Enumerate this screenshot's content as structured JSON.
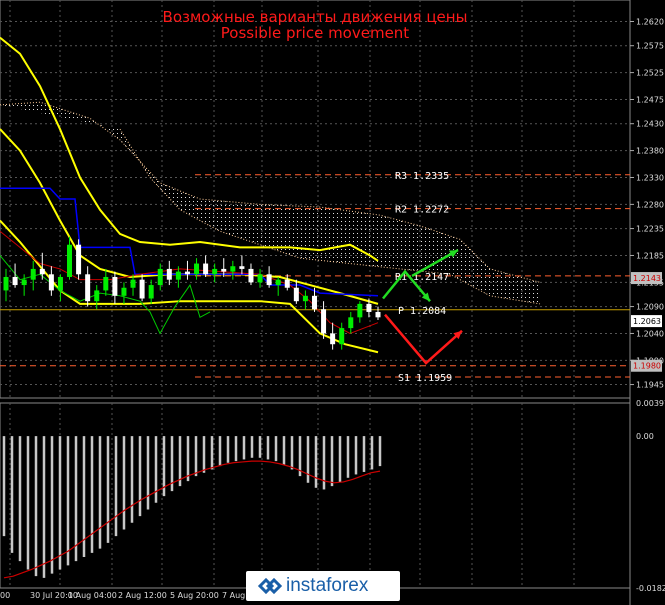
{
  "header": {
    "title_ru": "Возможные варианты движения цены",
    "title_en": "Possible price movement"
  },
  "chart_data": {
    "type": "candlestick",
    "instrument_note": "",
    "price_axis": {
      "ylim": [
        1.192,
        1.266
      ],
      "ticks": [
        "1.2620",
        "1.2575",
        "1.2525",
        "1.2475",
        "1.2430",
        "1.2380",
        "1.2330",
        "1.2280",
        "1.2235",
        "1.2185",
        "1.2135",
        "1.2090",
        "1.2040",
        "1.1990",
        "1.1945"
      ]
    },
    "current_price_tag": "1.2063",
    "marker_tags": [
      "1.2143",
      "1.1980"
    ],
    "time_axis": {
      "labels": [
        "00",
        "30 Jul 20:00",
        "1 Aug 04:00",
        "2 Aug 12:00",
        "5 Aug 20:00",
        "7 Aug"
      ]
    },
    "pivot_levels": [
      {
        "name": "R3",
        "label": "R3  1.2335",
        "value": 1.2335,
        "color": "#ff6030"
      },
      {
        "name": "R2",
        "label": "R2  1.2272",
        "value": 1.2272,
        "color": "#ff6030"
      },
      {
        "name": "R1",
        "label": "R1  1.2147",
        "value": 1.2147,
        "color": "#ff6030"
      },
      {
        "name": "P",
        "label": "P  1.2084",
        "value": 1.2084,
        "color": "#c8a000"
      },
      {
        "name": "S1",
        "label": "S1  1.1959",
        "value": 1.1959,
        "color": "#ff6030"
      }
    ],
    "forecast_arrows": [
      {
        "direction": "up-then-down",
        "color": "#22dd22",
        "points": [
          [
            0,
            1.2084
          ],
          [
            1,
            1.204
          ],
          [
            2,
            1.2185
          ]
        ]
      },
      {
        "direction": "down-then-up",
        "color": "#ff1a1a",
        "points": [
          [
            0,
            1.2084
          ],
          [
            1,
            1.199
          ],
          [
            2,
            1.204
          ]
        ]
      }
    ],
    "candles": [
      [
        1.212,
        1.216,
        1.21,
        1.2145
      ],
      [
        1.2145,
        1.217,
        1.2125,
        1.213
      ],
      [
        1.213,
        1.215,
        1.211,
        1.214
      ],
      [
        1.214,
        1.2175,
        1.212,
        1.216
      ],
      [
        1.216,
        1.219,
        1.214,
        1.215
      ],
      [
        1.215,
        1.2165,
        1.211,
        1.212
      ],
      [
        1.212,
        1.215,
        1.21,
        1.2145
      ],
      [
        1.2145,
        1.222,
        1.214,
        1.2205
      ],
      [
        1.2205,
        1.2215,
        1.214,
        1.215
      ],
      [
        1.215,
        1.2165,
        1.209,
        1.21
      ],
      [
        1.21,
        1.213,
        1.2085,
        1.212
      ],
      [
        1.212,
        1.216,
        1.211,
        1.2145
      ],
      [
        1.2145,
        1.2155,
        1.2095,
        1.211
      ],
      [
        1.211,
        1.2135,
        1.2095,
        1.2125
      ],
      [
        1.2125,
        1.215,
        1.211,
        1.214
      ],
      [
        1.214,
        1.215,
        1.21,
        1.2105
      ],
      [
        1.2105,
        1.214,
        1.2095,
        1.213
      ],
      [
        1.213,
        1.217,
        1.212,
        1.216
      ],
      [
        1.216,
        1.2175,
        1.213,
        1.214
      ],
      [
        1.214,
        1.2165,
        1.2125,
        1.2155
      ],
      [
        1.2155,
        1.2175,
        1.214,
        1.215
      ],
      [
        1.215,
        1.218,
        1.214,
        1.217
      ],
      [
        1.217,
        1.2185,
        1.2145,
        1.215
      ],
      [
        1.215,
        1.217,
        1.2135,
        1.216
      ],
      [
        1.216,
        1.218,
        1.2145,
        1.2155
      ],
      [
        1.2155,
        1.2175,
        1.214,
        1.2165
      ],
      [
        1.2165,
        1.2185,
        1.215,
        1.216
      ],
      [
        1.216,
        1.217,
        1.213,
        1.2135
      ],
      [
        1.2135,
        1.216,
        1.2125,
        1.215
      ],
      [
        1.215,
        1.2165,
        1.2125,
        1.213
      ],
      [
        1.213,
        1.2145,
        1.211,
        1.214
      ],
      [
        1.214,
        1.215,
        1.212,
        1.2125
      ],
      [
        1.2125,
        1.214,
        1.2095,
        1.21
      ],
      [
        1.21,
        1.212,
        1.2085,
        1.211
      ],
      [
        1.211,
        1.2125,
        1.208,
        1.2085
      ],
      [
        1.2085,
        1.21,
        1.203,
        1.204
      ],
      [
        1.204,
        1.206,
        1.201,
        1.202
      ],
      [
        1.202,
        1.206,
        1.201,
        1.205
      ],
      [
        1.205,
        1.208,
        1.204,
        1.207
      ],
      [
        1.207,
        1.21,
        1.206,
        1.2095
      ],
      [
        1.2095,
        1.2105,
        1.207,
        1.208
      ],
      [
        1.208,
        1.209,
        1.2065,
        1.207
      ]
    ],
    "oscillator": {
      "zero_label": "0.00",
      "ticks": [
        "0.00397",
        "0.00",
        "-0.01822"
      ],
      "ylim": [
        -0.01822,
        0.00397
      ],
      "histogram": [
        -0.012,
        -0.014,
        -0.015,
        -0.016,
        -0.0168,
        -0.017,
        -0.0165,
        -0.016,
        -0.0155,
        -0.015,
        -0.0145,
        -0.014,
        -0.0135,
        -0.0128,
        -0.012,
        -0.0112,
        -0.0104,
        -0.0096,
        -0.0088,
        -0.008,
        -0.0072,
        -0.0066,
        -0.006,
        -0.0054,
        -0.0048,
        -0.0044,
        -0.004,
        -0.0036,
        -0.0032,
        -0.003,
        -0.0028,
        -0.0026,
        -0.0026,
        -0.0028,
        -0.003,
        -0.0034,
        -0.004,
        -0.0048,
        -0.0056,
        -0.0062,
        -0.0064,
        -0.006,
        -0.0055,
        -0.005,
        -0.0046,
        -0.0043,
        -0.004,
        -0.0036
      ],
      "signal": [
        -0.017,
        -0.0168,
        -0.0164,
        -0.016,
        -0.0155,
        -0.015,
        -0.0144,
        -0.0138,
        -0.013,
        -0.0122,
        -0.0114,
        -0.0106,
        -0.0098,
        -0.009,
        -0.0083,
        -0.0076,
        -0.007,
        -0.0064,
        -0.0058,
        -0.0053,
        -0.0048,
        -0.0044,
        -0.004,
        -0.0037,
        -0.0034,
        -0.0032,
        -0.0031,
        -0.003,
        -0.003,
        -0.0031,
        -0.0033,
        -0.0036,
        -0.004,
        -0.0045,
        -0.005,
        -0.0054,
        -0.0056,
        -0.0055,
        -0.0052,
        -0.0048,
        -0.0044,
        -0.0042
      ]
    },
    "watermark": "instaforex",
    "colors": {
      "bull_candle": "#00ee00",
      "bear_candle": "#ffffff",
      "bollinger": "#ffff00",
      "kijun": "#0000ff",
      "tenkan": "#cc0000",
      "chikou": "#00cc00",
      "cloud": "#e0e0e0",
      "ma_red": "#cc0000",
      "pivot": "#ff6030",
      "grid": "#555555"
    }
  }
}
